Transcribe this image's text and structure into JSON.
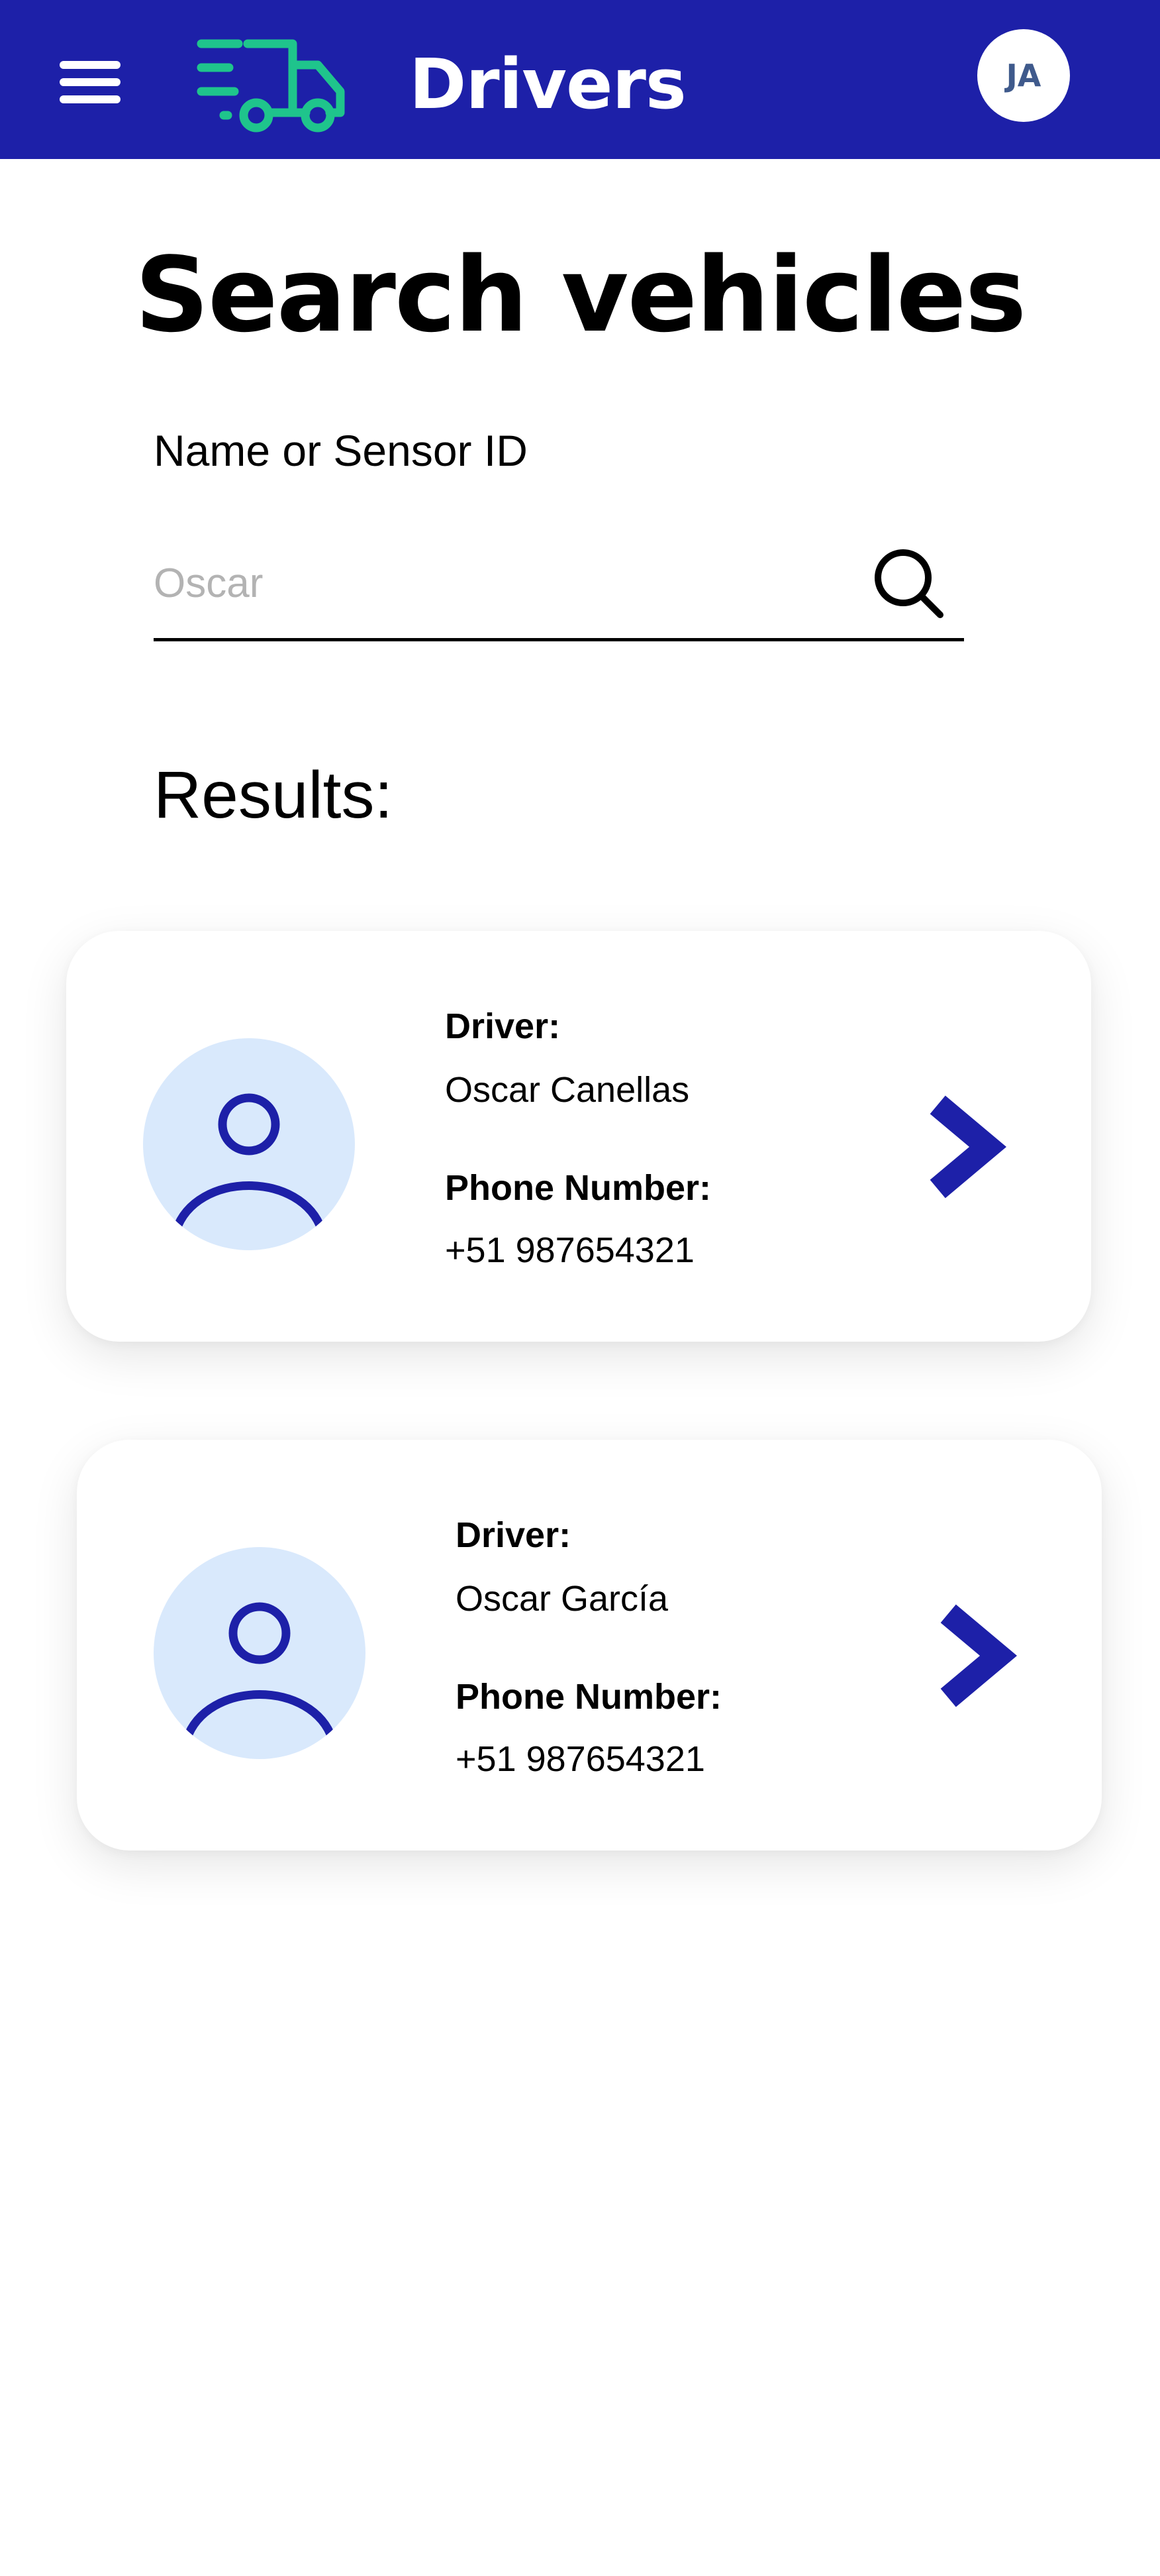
{
  "header": {
    "title": "Drivers",
    "avatar_initials": "JA",
    "menu_icon": "hamburger-menu-icon",
    "logo_icon": "delivery-truck-icon",
    "background_color": "#1d20a8",
    "logo_color": "#1fc48c"
  },
  "main": {
    "title": "Search vehicles",
    "search": {
      "label": "Name or Sensor ID",
      "placeholder": "Oscar",
      "value": "",
      "icon": "search-icon"
    },
    "results_label": "Results:",
    "results": [
      {
        "driver_label": "Driver:",
        "driver_name": "Oscar Canellas",
        "phone_label": "Phone Number:",
        "phone": "+51 987654321",
        "avatar_icon": "user-avatar-icon",
        "action_icon": "chevron-right-icon"
      },
      {
        "driver_label": "Driver:",
        "driver_name": "Oscar García",
        "phone_label": "Phone Number:",
        "phone": "+51 987654321",
        "avatar_icon": "user-avatar-icon",
        "action_icon": "chevron-right-icon"
      }
    ]
  },
  "colors": {
    "accent": "#1d20a8",
    "avatar_bg": "#d9e9fc"
  }
}
